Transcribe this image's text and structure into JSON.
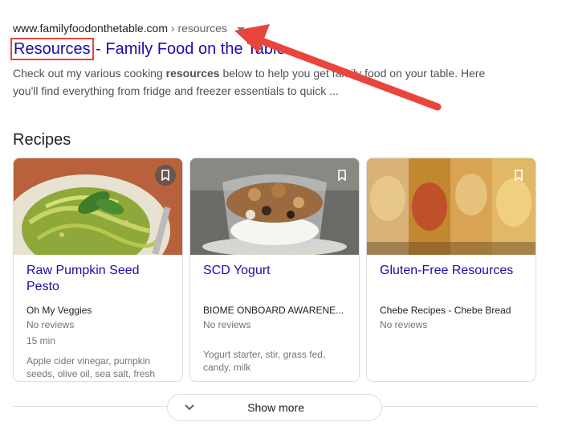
{
  "result": {
    "url_domain": "www.familyfoodonthetable.com",
    "url_path": " › resources",
    "title_highlight": "Resources",
    "title_rest": " - Family Food on the Table",
    "snippet_1": "Check out my various cooking ",
    "snippet_bold": "resources",
    "snippet_2": " below to help you get family food on your table. Here you'll find everything from fridge and freezer essentials to quick ..."
  },
  "recipes": {
    "heading": "Recipes",
    "cards": [
      {
        "title": "Raw Pumpkin Seed Pesto",
        "source": "Oh My Veggies",
        "reviews": "No reviews",
        "time": "15 min",
        "ingredients": "Apple cider vinegar, pumpkin seeds, olive oil, sea salt, fresh"
      },
      {
        "title": "SCD Yogurt",
        "source": "BIOME ONBOARD AWARENE...",
        "reviews": "No reviews",
        "time": "",
        "ingredients": "Yogurt starter, stir, grass fed, candy, milk"
      },
      {
        "title": "Gluten-Free Resources",
        "source": "Chebe Recipes - Chebe Bread",
        "reviews": "No reviews",
        "time": "",
        "ingredients": ""
      }
    ],
    "show_more": "Show more"
  },
  "icons": {
    "bookmark": "bookmark-icon",
    "chevron": "chevron-down-icon",
    "caret": "caret-down-icon"
  },
  "colors": {
    "link": "#1a0dab",
    "annotation": "#e8453c"
  }
}
